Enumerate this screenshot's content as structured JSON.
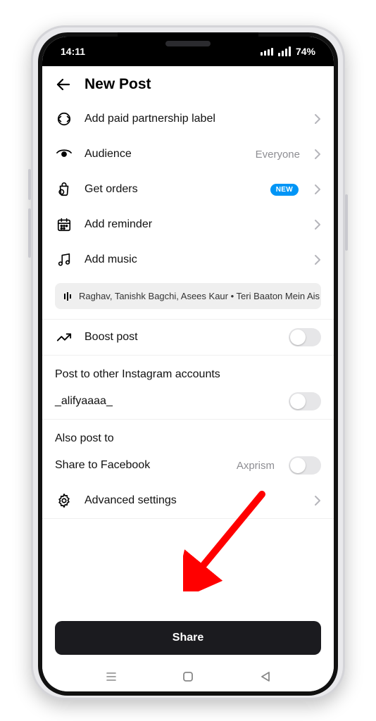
{
  "status": {
    "time": "14:11",
    "battery": "74%"
  },
  "header": {
    "title": "New Post"
  },
  "options": {
    "paid_partnership": {
      "label": "Add paid partnership label"
    },
    "audience": {
      "label": "Audience",
      "value": "Everyone"
    },
    "get_orders": {
      "label": "Get orders",
      "badge": "NEW"
    },
    "reminder": {
      "label": "Add reminder"
    },
    "music": {
      "label": "Add music"
    }
  },
  "music_suggestion": {
    "text": "Raghav, Tanishk Bagchi, Asees Kaur • Teri Baaton Mein Ais"
  },
  "boost": {
    "label": "Boost post",
    "enabled": false
  },
  "post_to_section": {
    "title": "Post to other Instagram accounts"
  },
  "accounts": [
    {
      "username": "_alifyaaaa_",
      "enabled": false
    }
  ],
  "also_post": {
    "title": "Also post to",
    "facebook": {
      "label": "Share to Facebook",
      "value": "Axprism",
      "enabled": false
    }
  },
  "advanced": {
    "label": "Advanced settings"
  },
  "share_button": {
    "label": "Share"
  }
}
